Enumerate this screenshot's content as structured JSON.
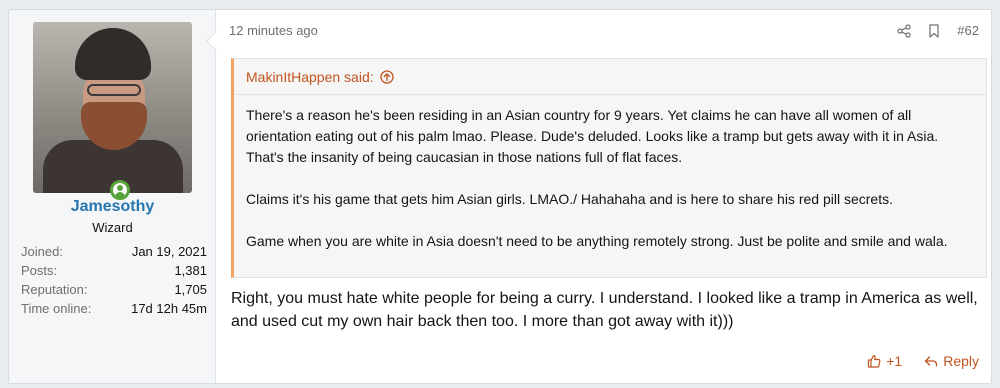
{
  "user": {
    "name": "Jamesothy",
    "title": "Wizard",
    "stats": [
      {
        "label": "Joined:",
        "value": "Jan 19, 2021"
      },
      {
        "label": "Posts:",
        "value": "1,381"
      },
      {
        "label": "Reputation:",
        "value": "1,705"
      },
      {
        "label": "Time online:",
        "value": "17d 12h 45m"
      }
    ]
  },
  "post": {
    "time": "12 minutes ago",
    "number": "#62",
    "quote": {
      "author": "MakinItHappen said:",
      "paragraphs": [
        "There's a reason he's been residing in an Asian country for 9 years. Yet claims he can have all women of all orientation eating out of his palm lmao. Please. Dude's deluded. Looks like a tramp but gets away with it in Asia. That's the insanity of being caucasian in those nations full of flat faces.",
        "Claims it's his game that gets him Asian girls. LMAO./ Hahahaha and is here to share his red pill secrets.",
        "Game when you are white in Asia doesn't need to be anything remotely strong. Just be polite and smile and wala."
      ]
    },
    "message": "Right, you must hate white people for being a curry. I understand. I looked like a tramp in America as well, and used cut my own hair back then too. I more than got away with it)))",
    "like_label": "+1",
    "reply_label": "Reply"
  },
  "colors": {
    "username": "#2577b1",
    "accent": "#c0541d",
    "quote_border": "#f4a460",
    "online": "#5aa33a"
  },
  "icons": [
    "share-icon",
    "bookmark-icon",
    "arrow-up-circle-icon",
    "thumbs-up-icon",
    "reply-icon",
    "online-status-icon"
  ]
}
